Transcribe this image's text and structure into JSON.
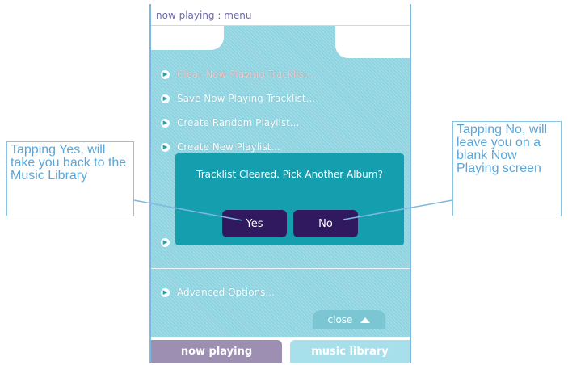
{
  "window": {
    "title": "now playing : menu"
  },
  "menu": {
    "items": [
      {
        "label": "Clear Now Playing Tracklist...",
        "state": "highlighted"
      },
      {
        "label": "Save Now Playing Tracklist..."
      },
      {
        "label": "Create Random Playlist..."
      },
      {
        "label": "Create New Playlist..."
      }
    ],
    "advanced_label": "Advanced Options...",
    "close_label": "close"
  },
  "dialog": {
    "message": "Tracklist Cleared. Pick Another Album?",
    "yes_label": "Yes",
    "no_label": "No"
  },
  "tabs": [
    {
      "label": "now playing",
      "color": "#9c8fb2"
    },
    {
      "label": "music library",
      "color": "#a7e0ea"
    }
  ],
  "callouts": {
    "left": "Tapping Yes, will take you back to the Music Library",
    "right": "Tapping No, will leave you on a blank Now Playing screen"
  },
  "colors": {
    "panel": "#8fd4e0",
    "dialog": "#159fae",
    "buttons": "#30195e",
    "callout_text": "#5aa6d8"
  }
}
